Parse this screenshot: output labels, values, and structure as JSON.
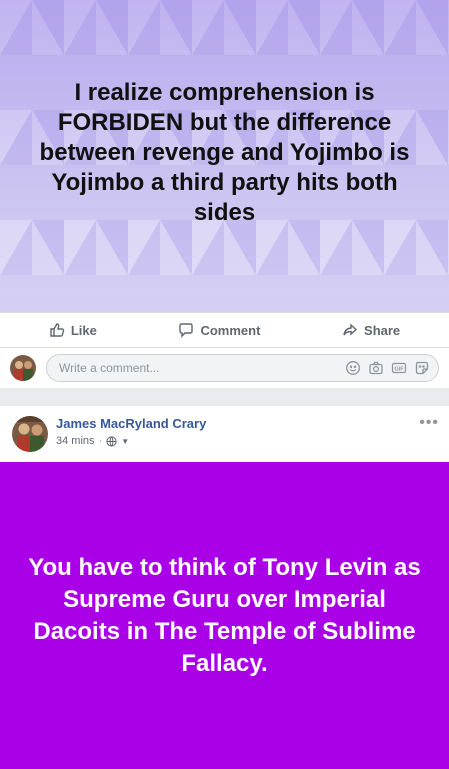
{
  "post1": {
    "background_text": "I realize comprehension is FORBIDEN but the difference between revenge and Yojimbo is Yojimbo a third party hits both sides",
    "actions": {
      "like": "Like",
      "comment": "Comment",
      "share": "Share"
    },
    "comment_box": {
      "placeholder": "Write a comment..."
    },
    "icons": [
      "emoji-icon",
      "camera-icon",
      "gif-icon",
      "sticker-icon"
    ]
  },
  "post2": {
    "author": "James MacRyland Crary",
    "time": "34 mins",
    "separator": "·",
    "privacy_icon": "globe-icon",
    "card_text": "You have to think of Tony Levin as Supreme Guru over Imperial Dacoits in The Temple of Sublime Fallacy.",
    "card_color": "#aa00e8"
  },
  "colors": {
    "link": "#365899",
    "action_gray": "#606770",
    "page_bg": "#e9ebee"
  }
}
